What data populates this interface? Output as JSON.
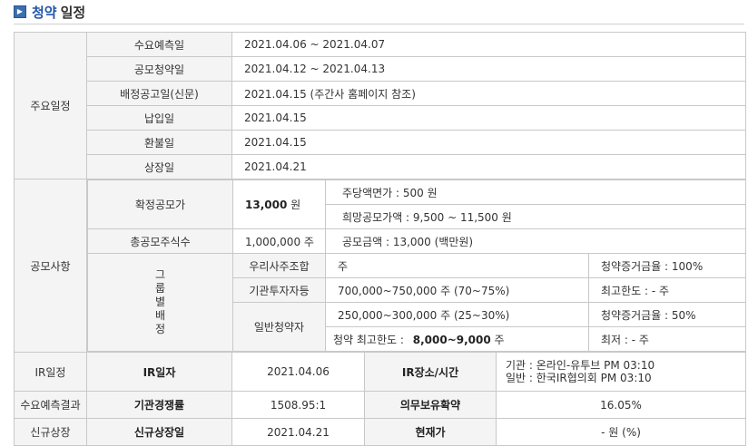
{
  "header": {
    "icon": "arrow-right-icon",
    "title_strong": "청약",
    "title_rest": "일정"
  },
  "schedule": {
    "section_label": "주요일정",
    "rows": [
      {
        "label": "수요예측일",
        "value": "2021.04.06   ~   2021.04.07"
      },
      {
        "label": "공모청약일",
        "value": "2021.04.12   ~   2021.04.13"
      },
      {
        "label": "배정공고일(신문)",
        "value": "2021.04.15 (주간사 홈페이지 참조)"
      },
      {
        "label": "납입일",
        "value": "2021.04.15"
      },
      {
        "label": "환불일",
        "value": "2021.04.15"
      },
      {
        "label": "상장일",
        "value": "2021.04.21"
      }
    ]
  },
  "offering": {
    "section_label": "공모사항",
    "confirmed_price_label": "확정공모가",
    "confirmed_price_value": "13,000",
    "confirmed_price_unit": "원",
    "par_value": "주당액면가 :   500 원",
    "hope_price": "희망공모가액 :   9,500 ~ 11,500 원",
    "total_shares_label": "총공모주식수",
    "total_shares_value": "1,000,000 주",
    "offering_amount": "공모금액 : 13,000 (백만원)",
    "group_label_chars": [
      "그",
      "룹",
      "별",
      "배",
      "정"
    ],
    "groups": {
      "employee_label": "우리사주조합",
      "employee_value": "주",
      "employee_deposit": "청약증거금율 : 100%",
      "institution_label": "기관투자자등",
      "institution_value": "700,000~750,000 주   (70~75%)",
      "institution_limit": "최고한도 :   - 주",
      "general_label": "일반청약자",
      "general_value": "250,000~300,000 주   (25~30%)",
      "general_deposit": "청약증거금율 : 50%",
      "general_max_label": "청약 최고한도 :",
      "general_max_value": "8,000~9,000",
      "general_max_unit": "주",
      "general_min": "최저 :   - 주"
    }
  },
  "ir": {
    "section_label": "IR일정",
    "date_label": "IR일자",
    "date_value": "2021.04.06",
    "place_label": "IR장소/시간",
    "place_institution": "기관 : 온라인-유투브 PM 03:10",
    "place_general": "일반 : 한국IR협의회 PM 03:10"
  },
  "demand": {
    "section_label": "수요예측결과",
    "competition_label": "기관경쟁률",
    "competition_value": "1508.95:1",
    "lockup_label": "의무보유확약",
    "lockup_value": "16.05%"
  },
  "listing": {
    "section_label": "신규상장",
    "date_label": "신규상장일",
    "date_value": "2021.04.21",
    "price_label": "현재가",
    "price_value": "- 원 (%)"
  }
}
